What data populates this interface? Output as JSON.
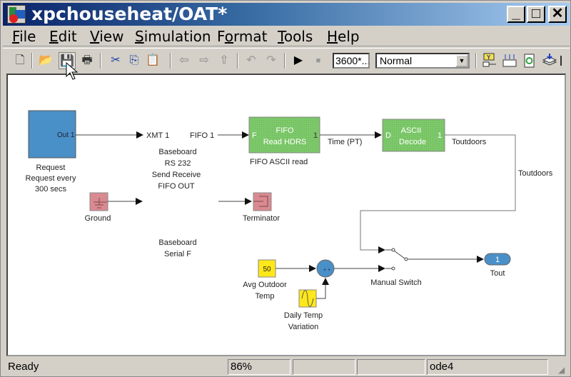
{
  "window": {
    "title": "xpchouseheat/OAT*",
    "controls": {
      "minimize": "_",
      "maximize": "□",
      "close": "✕"
    }
  },
  "menu": [
    {
      "label": "File",
      "mnemonic": "F",
      "rest": "ile"
    },
    {
      "label": "Edit",
      "mnemonic": "E",
      "rest": "dit"
    },
    {
      "label": "View",
      "mnemonic": "V",
      "rest": "iew"
    },
    {
      "label": "Simulation",
      "mnemonic": "S",
      "rest": "imulation"
    },
    {
      "label": "Format",
      "pre": "F",
      "mnemonic": "o",
      "rest": "rmat"
    },
    {
      "label": "Tools",
      "mnemonic": "T",
      "rest": "ools"
    },
    {
      "label": "Help",
      "mnemonic": "H",
      "rest": "elp"
    }
  ],
  "toolbar": {
    "icons": {
      "new": "🗋",
      "open": "📂",
      "save": "💾",
      "print": "🖶",
      "cut": "✂",
      "copy": "⎘",
      "paste": "📋",
      "back": "⇦",
      "forward": "⇨",
      "up": "⇧",
      "undo": "↶",
      "redo": "↷",
      "run": "▶",
      "stop": "■"
    },
    "stop_time": "3600*...",
    "sim_mode": "Normal"
  },
  "diagram": {
    "request_block": {
      "port": "Out 1",
      "name": "Request",
      "desc1": "Request every",
      "desc2": "300  secs"
    },
    "baseboard": {
      "in_port": "XMT  1",
      "out_port": "FIFO  1",
      "l1": "Baseboard",
      "l2": "RS  232",
      "l3": "Send Receive",
      "l4": "FIFO OUT",
      "s1": "Baseboard",
      "s2": "Serial F"
    },
    "fifo_read": {
      "l1": "FIFO",
      "l2": "Read HDRS",
      "in_port": "F",
      "out_port": "1",
      "name": "FIFO ASCII read"
    },
    "signal_time": "Time  (PT)",
    "ascii_decode": {
      "l1": "ASCII",
      "l2": "Decode",
      "in_port": "D",
      "out_port": "1"
    },
    "signal_toutdoors_1": "Toutdoors",
    "signal_toutdoors_2": "Toutdoors",
    "ground": {
      "name": "Ground"
    },
    "terminator": {
      "name": "Terminator"
    },
    "constant": {
      "value": "50",
      "name1": "Avg Outdoor",
      "name2": "Temp"
    },
    "sine": {
      "name1": "Daily Temp",
      "name2": "Variation"
    },
    "sum": {
      "signs": "+ +"
    },
    "switch": {
      "name": "Manual Switch"
    },
    "outport": {
      "value": "1",
      "name": "Tout"
    }
  },
  "status": {
    "message": "Ready",
    "zoom": "86%",
    "cell3": "",
    "cell4": "",
    "solver": "ode4"
  },
  "colors": {
    "request_fill": "#4a90c8",
    "green_block": "#7dc86a",
    "pink_block": "#d98a90",
    "yellow_block": "#ffe81a",
    "blue_round": "#4a90c8"
  }
}
